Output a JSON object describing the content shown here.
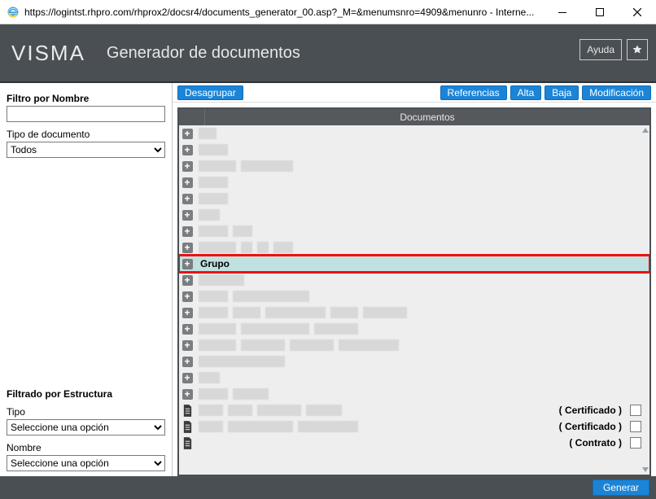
{
  "browser": {
    "url_display": "https://logintst.rhpro.com/rhprox2/docsr4/documents_generator_00.asp?_M=&menumsnro=4909&menunro - Interne..."
  },
  "header": {
    "logo_text": "VISMA",
    "page_title": "Generador de documentos",
    "help_label": "Ayuda"
  },
  "sidebar": {
    "filter_name_label": "Filtro por Nombre",
    "filter_name_value": "",
    "doc_type_label": "Tipo de documento",
    "doc_type_value": "Todos",
    "doc_type_options": [
      "Todos"
    ],
    "structure_filter_label": "Filtrado por Estructura",
    "type_label": "Tipo",
    "type_value": "Seleccione una opción",
    "type_options": [
      "Seleccione una opción"
    ],
    "name_label": "Nombre",
    "name_value": "Seleccione una opción",
    "name_options": [
      "Seleccione una opción"
    ]
  },
  "toolbar": {
    "ungroup_label": "Desagrupar",
    "references_label": "Referencias",
    "add_label": "Alta",
    "delete_label": "Baja",
    "modify_label": "Modificación"
  },
  "grid": {
    "column_title": "Documentos",
    "highlight_label": "Grupo",
    "group_rows_blur": [
      [
        26
      ],
      [
        40
      ],
      [
        50,
        120
      ],
      [
        40
      ],
      [
        40
      ],
      [
        30
      ],
      [
        40,
        70
      ],
      [
        50,
        70,
        90,
        120
      ],
      [],
      [
        60
      ],
      [
        40,
        140
      ],
      [
        40,
        80,
        160,
        200,
        260
      ],
      [
        50,
        140,
        200
      ],
      [
        50,
        110,
        170,
        250
      ],
      [
        110
      ],
      [
        30
      ],
      [
        40,
        90
      ]
    ],
    "doc_rows": [
      {
        "type_label": "( Certificado )",
        "blurs": [
          34,
          70,
          130,
          180
        ]
      },
      {
        "type_label": "( Certificado )",
        "blurs": [
          34,
          120,
          200
        ]
      },
      {
        "type_label": "( Contrato )",
        "blurs": []
      }
    ]
  },
  "footer": {
    "generate_label": "Generar"
  }
}
